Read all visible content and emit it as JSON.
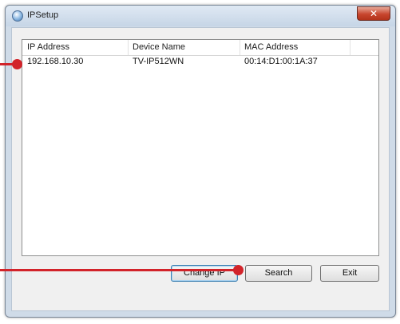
{
  "window": {
    "title": "IPSetup",
    "close_glyph": "✕",
    "icon": "globe-icon"
  },
  "list": {
    "columns": [
      "IP Address",
      "Device Name",
      "MAC Address"
    ],
    "rows": [
      {
        "ip": "192.168.10.30",
        "device": "TV-IP512WN",
        "mac": "00:14:D1:00:1A:37"
      }
    ]
  },
  "buttons": {
    "change_ip": "Change IP",
    "search": "Search",
    "exit": "Exit"
  },
  "colors": {
    "callout": "#d2232a",
    "window_frame": "#cfdbe8"
  }
}
